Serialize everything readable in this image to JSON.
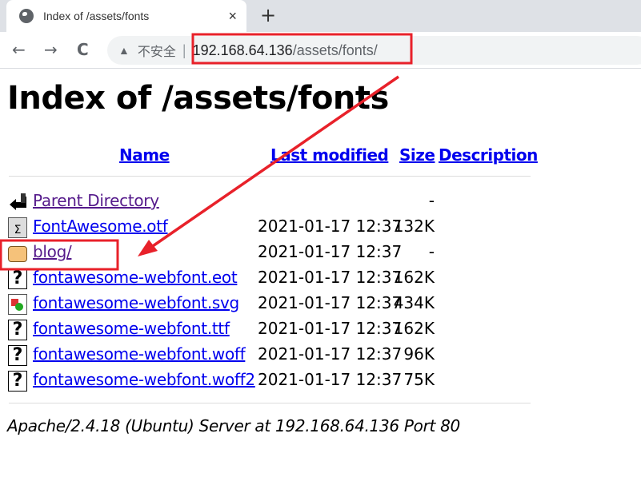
{
  "browser": {
    "tab_title": "Index of /assets/fonts",
    "close_label": "×",
    "new_tab_label": "+",
    "back_label": "←",
    "forward_label": "→",
    "reload_label": "C",
    "security_icon": "warning-triangle-icon",
    "security_label": "不安全",
    "url_host": "192.168.64.136",
    "url_path": "/assets/fonts/"
  },
  "page": {
    "title": "Index of /assets/fonts",
    "columns": {
      "name": "Name",
      "modified": "Last modified",
      "size": "Size",
      "description": "Description"
    },
    "rows": [
      {
        "icon": "back-icon",
        "name": "Parent Directory",
        "modified": "",
        "size": "-",
        "visited": true
      },
      {
        "icon": "font-file-icon",
        "name": "FontAwesome.otf",
        "modified": "2021-01-17 12:37",
        "size": "132K"
      },
      {
        "icon": "folder-icon",
        "name": "blog/",
        "modified": "2021-01-17 12:37",
        "size": "-",
        "visited": true
      },
      {
        "icon": "unknown-file-icon",
        "name": "fontawesome-webfont.eot",
        "modified": "2021-01-17 12:37",
        "size": "162K"
      },
      {
        "icon": "image-file-icon",
        "name": "fontawesome-webfont.svg",
        "modified": "2021-01-17 12:37",
        "size": "434K"
      },
      {
        "icon": "unknown-file-icon",
        "name": "fontawesome-webfont.ttf",
        "modified": "2021-01-17 12:37",
        "size": "162K"
      },
      {
        "icon": "unknown-file-icon",
        "name": "fontawesome-webfont.woff",
        "modified": "2021-01-17 12:37",
        "size": "96K"
      },
      {
        "icon": "unknown-file-icon",
        "name": "fontawesome-webfont.woff2",
        "modified": "2021-01-17 12:37",
        "size": "75K"
      }
    ],
    "footer": "Apache/2.4.18 (Ubuntu) Server at 192.168.64.136 Port 80"
  },
  "colors": {
    "annotation": "#e8212a",
    "link": "#0000ee",
    "visited": "#551a8b"
  }
}
